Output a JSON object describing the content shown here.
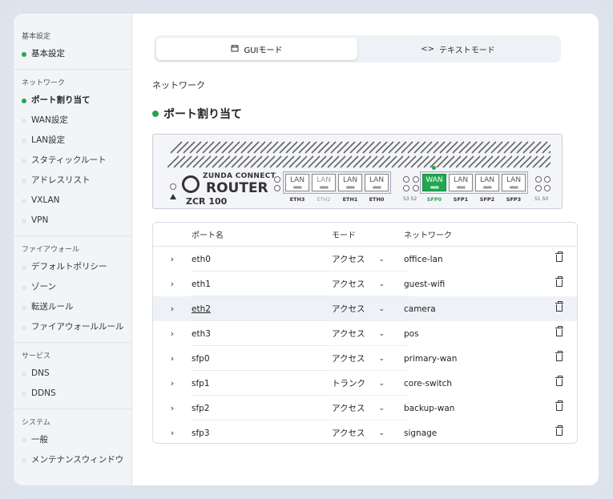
{
  "sidebar": {
    "sections": [
      {
        "heading": "基本設定",
        "items": [
          {
            "label": "基本設定",
            "active": true
          }
        ]
      },
      {
        "heading": "ネットワーク",
        "items": [
          {
            "label": "ポート割り当て",
            "active": true,
            "selected": true
          },
          {
            "label": "WAN設定"
          },
          {
            "label": "LAN設定"
          },
          {
            "label": "スタティックルート"
          },
          {
            "label": "アドレスリスト"
          },
          {
            "label": "VXLAN"
          },
          {
            "label": "VPN"
          }
        ]
      },
      {
        "heading": "ファイアウォール",
        "items": [
          {
            "label": "デフォルトポリシー"
          },
          {
            "label": "ゾーン"
          },
          {
            "label": "転送ルール"
          },
          {
            "label": "ファイアウォールルール"
          }
        ]
      },
      {
        "heading": "サービス",
        "items": [
          {
            "label": "DNS"
          },
          {
            "label": "DDNS"
          }
        ]
      },
      {
        "heading": "システム",
        "items": [
          {
            "label": "一般"
          },
          {
            "label": "メンテナンスウィンドウ"
          }
        ]
      }
    ]
  },
  "mode_toggle": {
    "gui_label": "GUIモード",
    "text_label": "テキストモード",
    "gui_icon": "calendar-icon",
    "text_icon": "code-icon",
    "selected": "gui"
  },
  "breadcrumb": "ネットワーク",
  "page_title": "ポート割り当て",
  "router": {
    "brand": "ZUNDA CONNECT",
    "product": "ROUTER",
    "model": "ZCR 100",
    "eth_ports": [
      {
        "type": "LAN",
        "label": "ETH3",
        "dim": false
      },
      {
        "type": "LAN",
        "label": "ETH2",
        "dim": true
      },
      {
        "type": "LAN",
        "label": "ETH1",
        "dim": false
      },
      {
        "type": "LAN",
        "label": "ETH0",
        "dim": false
      }
    ],
    "sfp_ports": [
      {
        "type": "WAN",
        "label": "SFP0",
        "wan": true
      },
      {
        "type": "LAN",
        "label": "SFP1"
      },
      {
        "type": "LAN",
        "label": "SFP2"
      },
      {
        "type": "LAN",
        "label": "SFP3"
      }
    ],
    "left_status": "S3 S2",
    "right_status": "S1 S0"
  },
  "table": {
    "headers": {
      "name": "ポート名",
      "mode": "モード",
      "network": "ネットワーク"
    },
    "rows": [
      {
        "name": "eth0",
        "mode": "アクセス",
        "network": "office-lan"
      },
      {
        "name": "eth1",
        "mode": "アクセス",
        "network": "guest-wifi"
      },
      {
        "name": "eth2",
        "mode": "アクセス",
        "network": "camera",
        "highlight": true
      },
      {
        "name": "eth3",
        "mode": "アクセス",
        "network": "pos"
      },
      {
        "name": "sfp0",
        "mode": "アクセス",
        "network": "primary-wan"
      },
      {
        "name": "sfp1",
        "mode": "トランク",
        "network": "core-switch"
      },
      {
        "name": "sfp2",
        "mode": "アクセス",
        "network": "backup-wan"
      },
      {
        "name": "sfp3",
        "mode": "アクセス",
        "network": "signage"
      }
    ]
  },
  "colors": {
    "accent": "#22a651",
    "sidebar_bg": "#f2f4f8"
  }
}
